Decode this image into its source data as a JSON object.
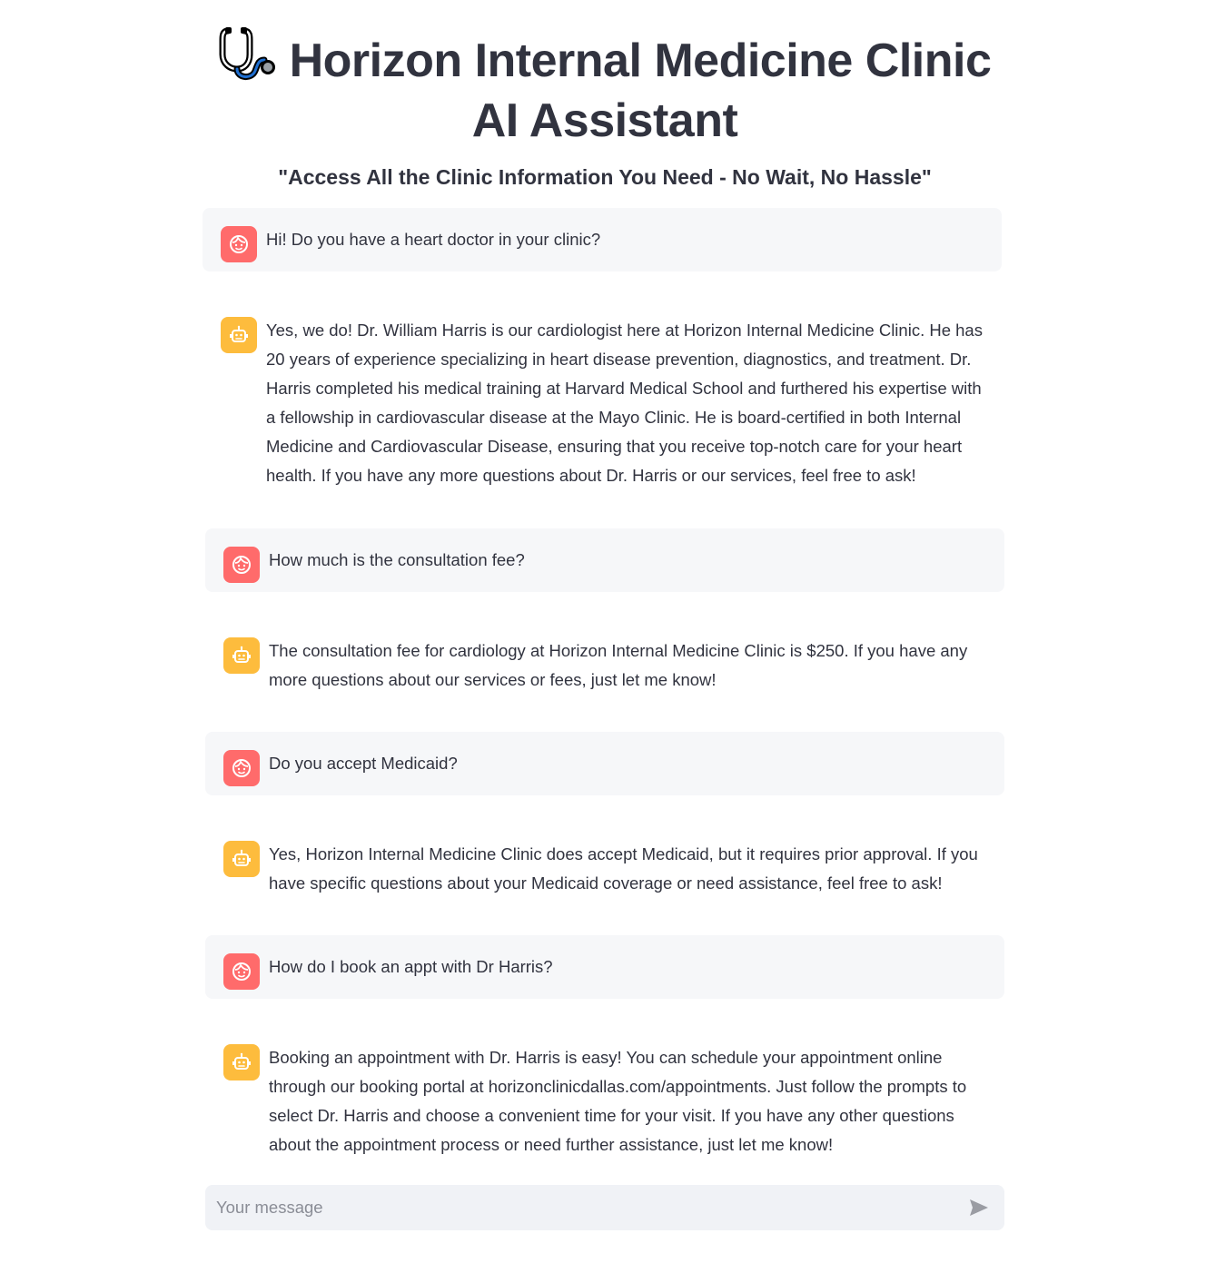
{
  "header": {
    "title": "Horizon Internal Medicine Clinic AI Assistant",
    "subtitle": "\"Access All the Clinic Information You Need - No Wait, No Hassle\"",
    "logo_icon": "stethoscope-icon"
  },
  "colors": {
    "user_avatar": "#ff6b6b",
    "assistant_avatar": "#fdbc3d",
    "user_bubble": "#f6f7f9",
    "input_background": "#f0f2f6",
    "text": "#31333f"
  },
  "messages": [
    {
      "role": "user",
      "icon": "user-face-icon",
      "text": "Hi! Do you have a heart doctor in your clinic?"
    },
    {
      "role": "assistant",
      "icon": "robot-icon",
      "text": "Yes, we do! Dr. William Harris is our cardiologist here at Horizon Internal Medicine Clinic. He has 20 years of experience specializing in heart disease prevention, diagnostics, and treatment. Dr. Harris completed his medical training at Harvard Medical School and furthered his expertise with a fellowship in cardiovascular disease at the Mayo Clinic. He is board-certified in both Internal Medicine and Cardiovascular Disease, ensuring that you receive top-notch care for your heart health. If you have any more questions about Dr. Harris or our services, feel free to ask!"
    },
    {
      "role": "user",
      "icon": "user-face-icon",
      "text": "How much is the consultation fee?"
    },
    {
      "role": "assistant",
      "icon": "robot-icon",
      "text": "The consultation fee for cardiology at Horizon Internal Medicine Clinic is $250. If you have any more questions about our services or fees, just let me know!"
    },
    {
      "role": "user",
      "icon": "user-face-icon",
      "text": "Do you accept Medicaid?"
    },
    {
      "role": "assistant",
      "icon": "robot-icon",
      "text": "Yes, Horizon Internal Medicine Clinic does accept Medicaid, but it requires prior approval. If you have specific questions about your Medicaid coverage or need assistance, feel free to ask!"
    },
    {
      "role": "user",
      "icon": "user-face-icon",
      "text": "How do I book an appt with Dr Harris?"
    },
    {
      "role": "assistant",
      "icon": "robot-icon",
      "text": "Booking an appointment with Dr. Harris is easy! You can schedule your appointment online through our booking portal at horizonclinicdallas.com/appointments. Just follow the prompts to select Dr. Harris and choose a convenient time for your visit. If you have any other questions about the appointment process or need further assistance, just let me know!"
    }
  ],
  "chat_input": {
    "placeholder": "Your message",
    "value": "",
    "send_icon": "send-arrow-icon"
  }
}
